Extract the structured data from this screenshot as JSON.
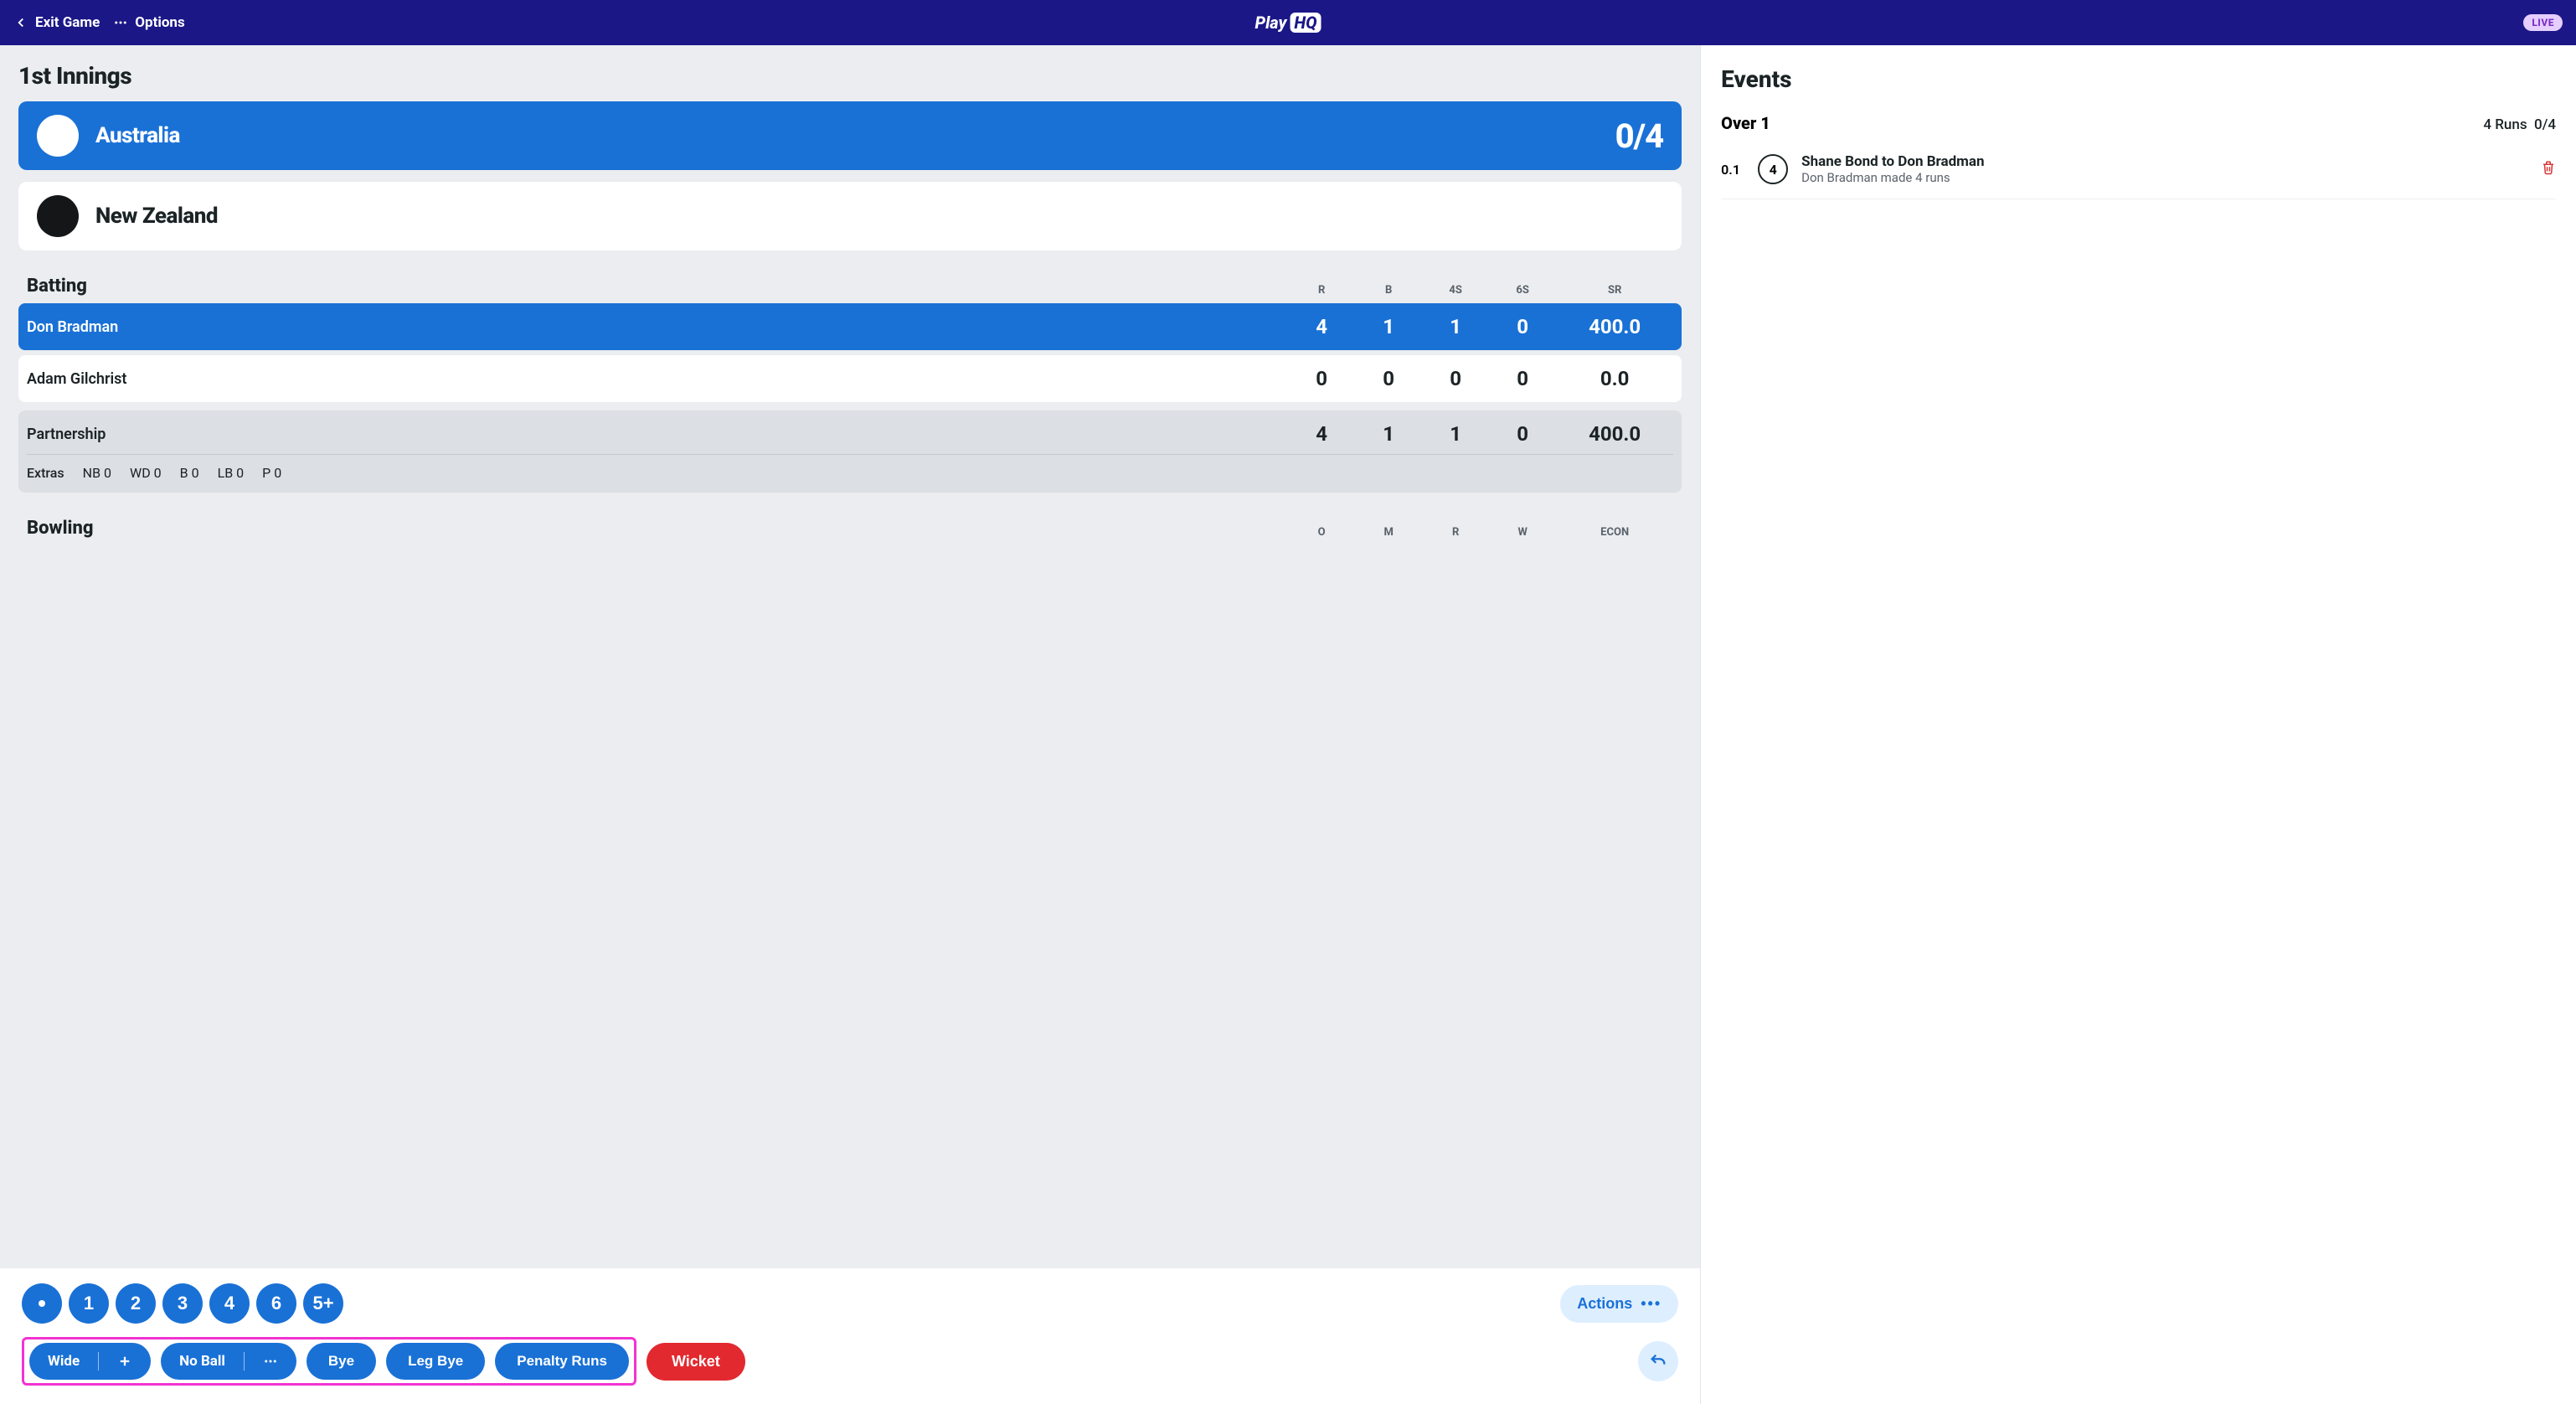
{
  "topbar": {
    "exit": "Exit Game",
    "options": "Options",
    "brand_play": "Play",
    "brand_hq": "HQ",
    "live": "LIVE"
  },
  "innings": {
    "title": "1st Innings",
    "batting_team": {
      "name": "Australia",
      "score": "0/4"
    },
    "bowling_team": {
      "name": "New Zealand"
    }
  },
  "batting": {
    "title": "Batting",
    "cols": [
      "R",
      "B",
      "4S",
      "6S",
      "SR"
    ],
    "rows": [
      {
        "name": "Don Bradman",
        "R": "4",
        "B": "1",
        "fours": "1",
        "sixes": "0",
        "SR": "400.0",
        "on_strike": true
      },
      {
        "name": "Adam Gilchrist",
        "R": "0",
        "B": "0",
        "fours": "0",
        "sixes": "0",
        "SR": "0.0",
        "on_strike": false
      }
    ],
    "partnership": {
      "label": "Partnership",
      "R": "4",
      "B": "1",
      "fours": "1",
      "sixes": "0",
      "SR": "400.0"
    },
    "extras": {
      "label": "Extras",
      "NB": "NB 0",
      "WD": "WD 0",
      "B": "B 0",
      "LB": "LB 0",
      "P": "P 0"
    }
  },
  "bowling": {
    "title": "Bowling",
    "cols": [
      "O",
      "M",
      "R",
      "W",
      "ECON"
    ]
  },
  "actions": {
    "runs": [
      "1",
      "2",
      "3",
      "4",
      "6",
      "5+"
    ],
    "actions_label": "Actions",
    "wide": "Wide",
    "noball": "No Ball",
    "bye": "Bye",
    "legbye": "Leg Bye",
    "penalty": "Penalty Runs",
    "wicket": "Wicket"
  },
  "events": {
    "title": "Events",
    "over": {
      "label": "Over 1",
      "summary_runs": "4 Runs",
      "summary_score": "0/4"
    },
    "items": [
      {
        "ball": "0.1",
        "value": "4",
        "line1": "Shane Bond to Don Bradman",
        "line2": "Don Bradman made 4 runs"
      }
    ]
  }
}
